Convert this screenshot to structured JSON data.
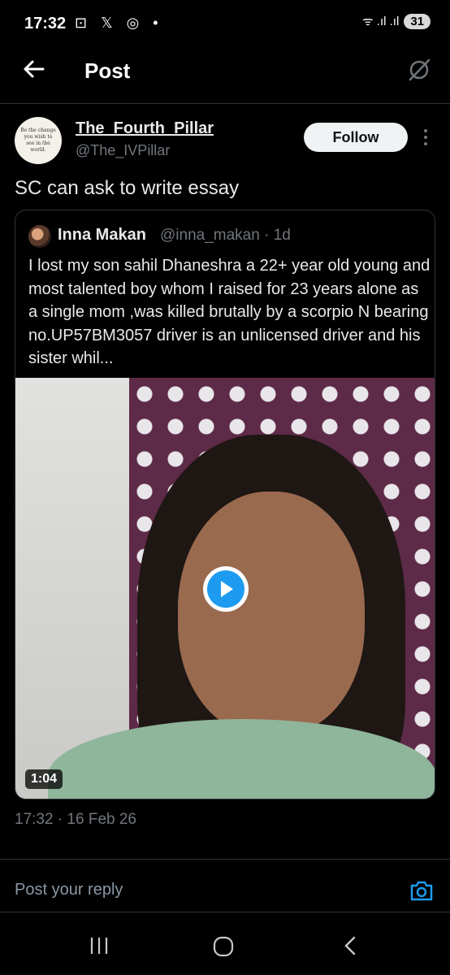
{
  "status_bar": {
    "time": "17:32",
    "icons_left": "⊡ 𝕏 ◎ •",
    "signal": "ᯤ .ıl .ıl",
    "battery": "31"
  },
  "header": {
    "title": "Post"
  },
  "post": {
    "author_name": "The_Fourth_Pillar",
    "author_handle": "@The_IVPillar",
    "avatar_text": "Be the change you wish to see in the world.",
    "follow_label": "Follow",
    "text": "SC can ask to write essay",
    "timestamp": "17:32 · 16 Feb 26"
  },
  "quoted": {
    "name": "Inna Makan",
    "handle_time": "@inna_makan · 1d",
    "text": "I lost my son sahil Dhaneshra a 22+ year old young and most talented boy whom I raised for 23 years alone as a single mom ,was killed brutally by a scorpio N bearing no.UP57BM3057 driver is an unlicensed driver and his sister whil...",
    "video_duration": "1:04"
  },
  "reply": {
    "placeholder": "Post your reply"
  },
  "colors": {
    "background": "#000000",
    "accent": "#1d9bf0",
    "secondary_text": "#71767b",
    "divider": "#2f3336"
  }
}
